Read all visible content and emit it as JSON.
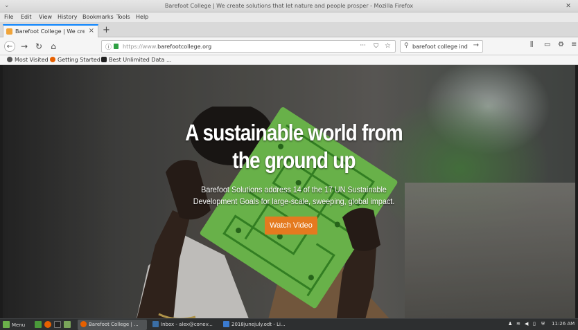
{
  "window": {
    "title": "Barefoot College | We create solutions that let nature and people prosper - Mozilla Firefox"
  },
  "menu": [
    "File",
    "Edit",
    "View",
    "History",
    "Bookmarks",
    "Tools",
    "Help"
  ],
  "tab": {
    "title": "Barefoot College | We create",
    "new_tab_label": "+"
  },
  "nav": {
    "url_scheme": "https://www.",
    "url_host": "barefootcollege.org",
    "more_label": "···",
    "search_value": "barefoot college india"
  },
  "bookmarks": [
    {
      "label": "Most Visited",
      "color": "#555555"
    },
    {
      "label": "Getting Started",
      "color": "#e66000"
    },
    {
      "label": "Best Unlimited Data ...",
      "color": "#222222"
    }
  ],
  "hero": {
    "headline": "A sustainable world from the ground up",
    "subtitle": "Barefoot Solutions address 14 of the 17 UN Sustainable Development Goals for large-scale, sweeping, global impact.",
    "button_label": "Watch Video",
    "button_color": "#e47a1f"
  },
  "taskbar": {
    "menu_label": "Menu",
    "windows": [
      {
        "label": "Barefoot College | ...",
        "active": true
      },
      {
        "label": "Inbox - alex@conev...",
        "active": false
      },
      {
        "label": "2018junejuly.odt - Li...",
        "active": false
      }
    ],
    "clock": "11:26 AM"
  }
}
